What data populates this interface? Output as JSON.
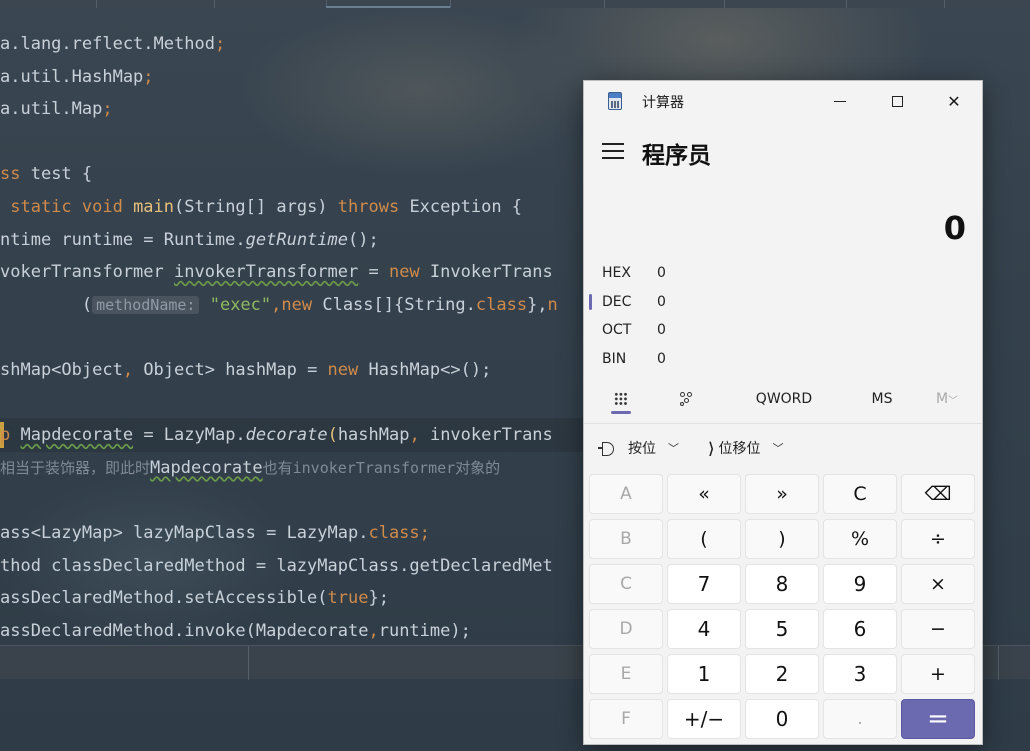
{
  "ide": {
    "lines": [
      {
        "parts": [
          [
            "",
            "a.lang.reflect.Method"
          ],
          [
            "kw",
            ";"
          ]
        ]
      },
      {
        "parts": [
          [
            "",
            "a.util.HashMap"
          ],
          [
            "kw",
            ";"
          ]
        ]
      },
      {
        "parts": [
          [
            "",
            "a.util.Map"
          ],
          [
            "kw",
            ";"
          ]
        ]
      },
      {
        "parts": []
      },
      {
        "parts": [
          [
            "kw",
            "ss "
          ],
          [
            "",
            "test {"
          ]
        ]
      },
      {
        "parts": [
          [
            "kw",
            " static void "
          ],
          [
            "fn",
            "main"
          ],
          [
            "",
            "(String[] args) "
          ],
          [
            "kw",
            "throws "
          ],
          [
            "",
            "Exception {"
          ]
        ]
      },
      {
        "parts": [
          [
            "",
            "ntime runtime = Runtime."
          ],
          [
            "it",
            "getRuntime"
          ],
          [
            "",
            "();"
          ]
        ]
      },
      {
        "parts": [
          [
            "",
            "vokerTransformer "
          ],
          [
            "uw",
            "invokerTransformer"
          ],
          [
            "",
            " = "
          ],
          [
            "kw",
            "new "
          ],
          [
            "",
            "InvokerTrans"
          ]
        ]
      },
      {
        "parts": [
          [
            "",
            "        ("
          ],
          [
            "hint",
            "methodName:"
          ],
          [
            "",
            " "
          ],
          [
            "str",
            "\"exec\""
          ],
          [
            "kw",
            ","
          ],
          [
            "kw",
            "new "
          ],
          [
            "",
            "Class[]{String."
          ],
          [
            "kw",
            "class"
          ],
          [
            "",
            "},"
          ],
          [
            "kw",
            "n"
          ]
        ]
      },
      {
        "parts": []
      },
      {
        "parts": [
          [
            "",
            "shMap<Object"
          ],
          [
            "kw",
            ","
          ],
          [
            "",
            " Object> hashMap = "
          ],
          [
            "kw",
            "new "
          ],
          [
            "",
            "HashMap<>();"
          ]
        ]
      },
      {
        "parts": []
      },
      {
        "parts": [
          [
            "kw",
            "p "
          ],
          [
            "uw",
            "Mapdecorate"
          ],
          [
            "",
            " = LazyMap."
          ],
          [
            "it",
            "decorate"
          ],
          [
            "fn",
            "("
          ],
          [
            "",
            "hashMap"
          ],
          [
            "kw",
            ","
          ],
          [
            "",
            " invokerTrans"
          ]
        ]
      },
      {
        "parts": [
          [
            "comment",
            "相当于装饰器，即此时"
          ],
          [
            "uw",
            "Mapdecorate"
          ],
          [
            "comment",
            "也有invokerTransformer对象的"
          ]
        ]
      },
      {
        "parts": []
      },
      {
        "parts": [
          [
            "",
            "ass<LazyMap> lazyMapClass = LazyMap."
          ],
          [
            "kw",
            "class"
          ],
          [
            "kw",
            ";"
          ]
        ]
      },
      {
        "parts": [
          [
            "",
            "thod classDeclaredMethod = lazyMapClass.getDeclaredMet"
          ]
        ]
      },
      {
        "parts": [
          [
            "",
            "assDeclaredMethod.setAccessible("
          ],
          [
            "kw",
            "true"
          ],
          [
            "",
            "};"
          ]
        ]
      },
      {
        "parts": [
          [
            "",
            "assDeclaredMethod.invoke(Mapdecorate"
          ],
          [
            "kw",
            ","
          ],
          [
            "",
            "runtime);"
          ]
        ]
      }
    ]
  },
  "calculator": {
    "title": "计算器",
    "mode": "程序员",
    "display": "0",
    "radix": [
      {
        "label": "HEX",
        "value": "0"
      },
      {
        "label": "DEC",
        "value": "0"
      },
      {
        "label": "OCT",
        "value": "0"
      },
      {
        "label": "BIN",
        "value": "0"
      }
    ],
    "word_size": "QWORD",
    "memory_store": "MS",
    "memory_view": "M",
    "bitwise_label": "按位",
    "bitshift_label": "位移位",
    "keys": [
      [
        "A",
        "«",
        "»",
        "C",
        "⌫"
      ],
      [
        "B",
        "(",
        ")",
        "%",
        "÷"
      ],
      [
        "C",
        "7",
        "8",
        "9",
        "×"
      ],
      [
        "D",
        "4",
        "5",
        "6",
        "−"
      ],
      [
        "E",
        "1",
        "2",
        "3",
        "+"
      ],
      [
        "F",
        "+/−",
        "0",
        ".",
        "="
      ]
    ]
  }
}
